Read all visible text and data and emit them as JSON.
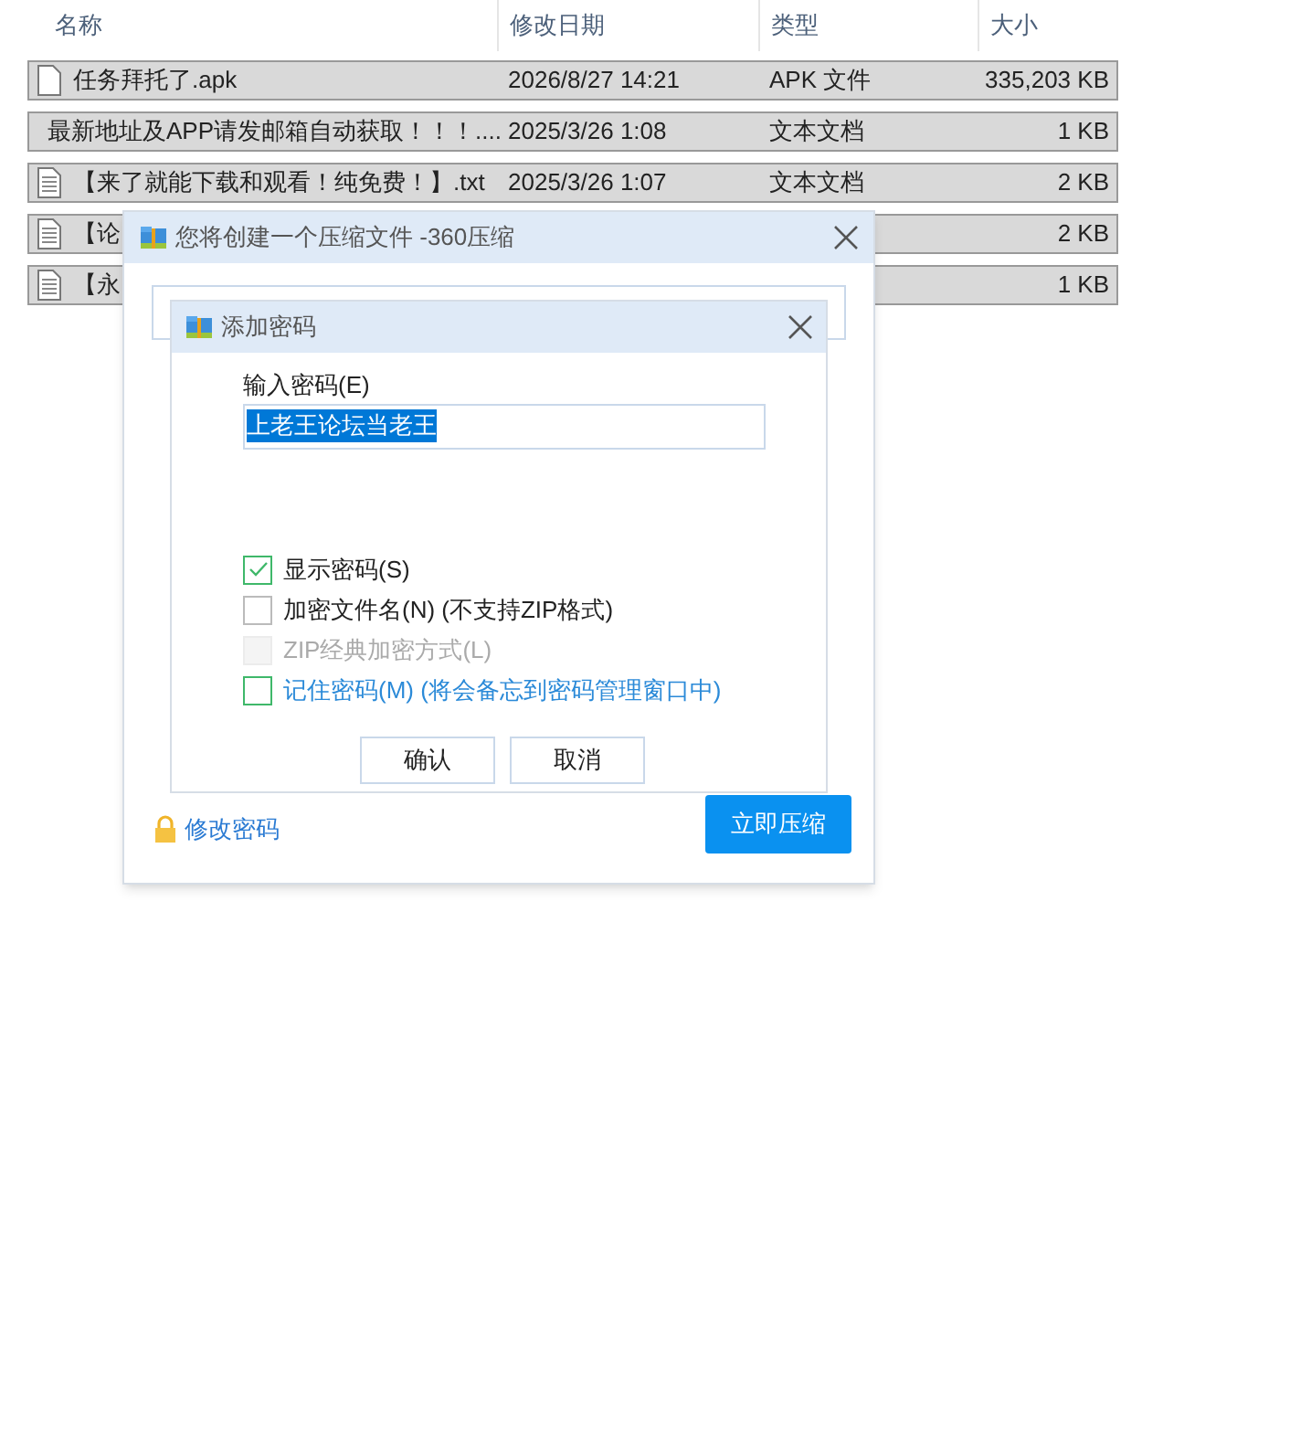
{
  "file_list": {
    "columns": [
      "名称",
      "修改日期",
      "类型",
      "大小"
    ],
    "rows": [
      {
        "name": "任务拜托了.apk",
        "kind": "file",
        "date": "2026/8/27 14:21",
        "type": "APK 文件",
        "size": "335,203 KB",
        "selected": true
      },
      {
        "name": "最新地址及APP请发邮箱自动获取！！！....",
        "kind": "text",
        "date": "2025/3/26 1:08",
        "type": "文本文档",
        "size": "1 KB",
        "selected": true
      },
      {
        "name": "【来了就能下载和观看！纯免费！】.txt",
        "kind": "text",
        "date": "2025/3/26 1:07",
        "type": "文本文档",
        "size": "2 KB",
        "selected": true
      },
      {
        "name": "【论",
        "kind": "text",
        "size": "2 KB",
        "selected": true
      },
      {
        "name": "【永",
        "kind": "text",
        "size": "1 KB",
        "selected": true
      }
    ]
  },
  "compress_dialog": {
    "title": "您将创建一个压缩文件 -360压缩",
    "change_password": "修改密码",
    "compress_button": "立即压缩"
  },
  "password_dialog": {
    "title": "添加密码",
    "field_label": "输入密码(E)",
    "password": "上老王论坛当老王",
    "options": [
      {
        "label": "显示密码(S)",
        "checked": true,
        "disabled": false,
        "highlight": false
      },
      {
        "label": "加密文件名(N) (不支持ZIP格式)",
        "checked": false,
        "disabled": false,
        "highlight": false
      },
      {
        "label": "ZIP经典加密方式(L)",
        "checked": false,
        "disabled": true,
        "highlight": false
      },
      {
        "label": "记住密码(M) (将会备忘到密码管理窗口中)",
        "checked": false,
        "disabled": false,
        "highlight": true
      }
    ],
    "buttons": [
      "确认",
      "取消"
    ]
  }
}
